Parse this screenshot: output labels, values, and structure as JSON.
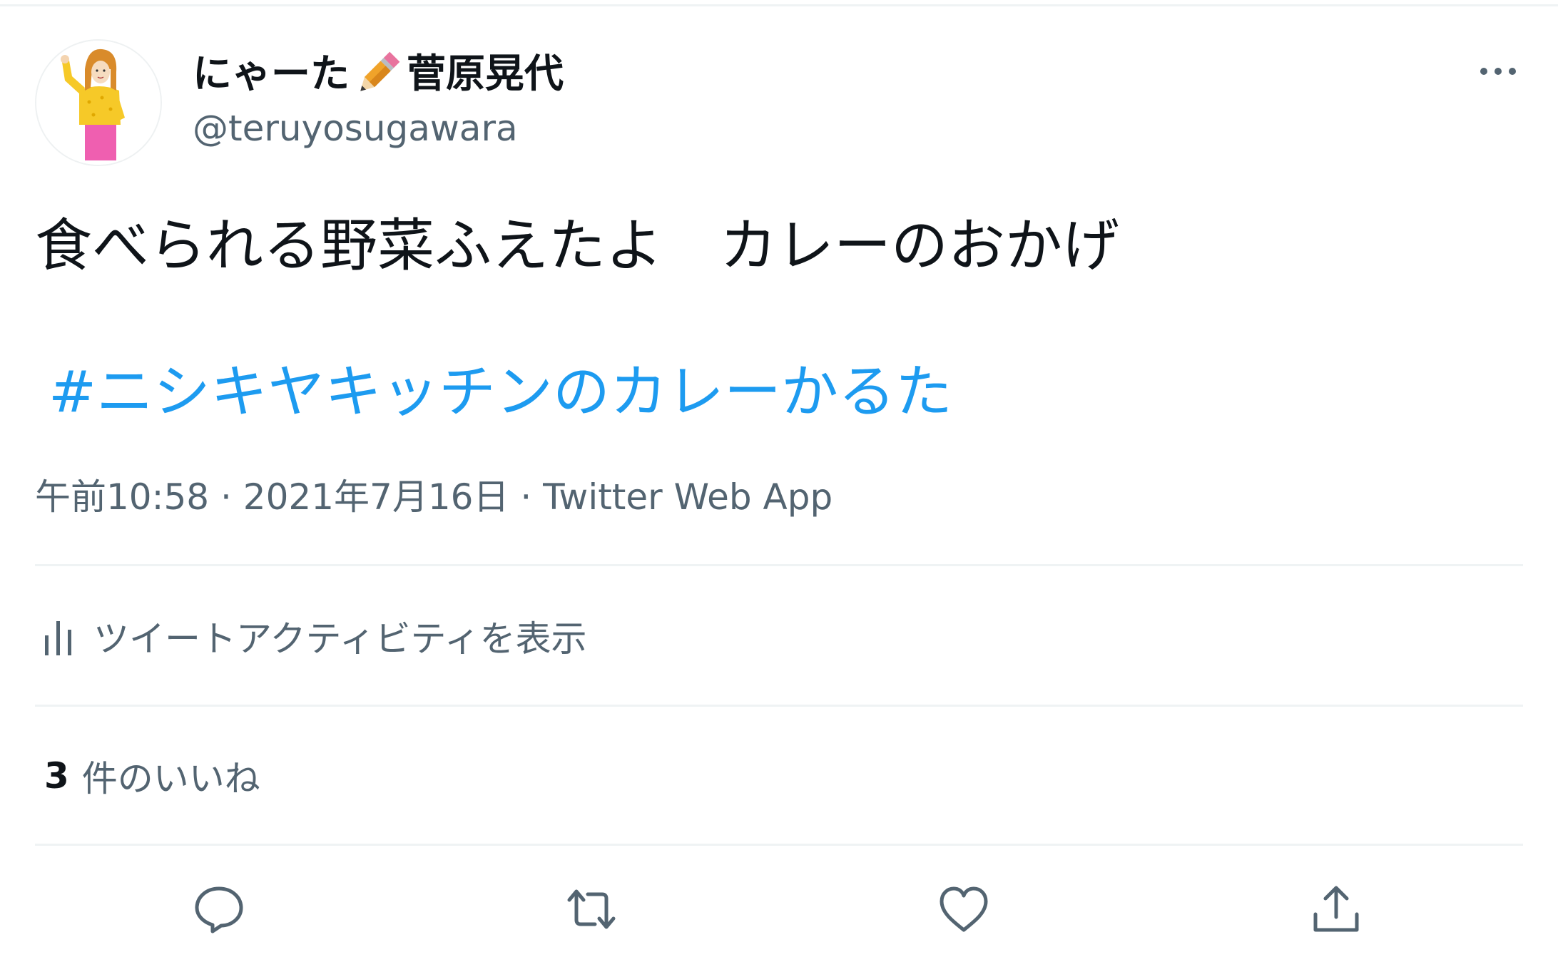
{
  "tweet": {
    "author": {
      "display_name_prefix": "にゃーた",
      "display_name_emoji": "pencil-icon",
      "display_name_suffix": "菅原晃代",
      "handle": "@teruyosugawara",
      "avatar": "avatar-illustration"
    },
    "more_icon": "more-horizontal-icon",
    "text": "食べられる野菜ふえたよ　カレーのおかげ",
    "hashtag": "#ニシキヤキッチンのカレーかるた",
    "meta": {
      "time": "午前10:58",
      "separator": " · ",
      "date": "2021年7月16日",
      "source": "Twitter Web App"
    },
    "activity_label": "ツイートアクティビティを表示",
    "likes": {
      "count": "3",
      "label": "件のいいね"
    },
    "actions": [
      {
        "name": "reply",
        "icon": "reply-icon"
      },
      {
        "name": "retweet",
        "icon": "retweet-icon"
      },
      {
        "name": "like",
        "icon": "heart-icon"
      },
      {
        "name": "share",
        "icon": "share-icon"
      }
    ]
  },
  "colors": {
    "text_primary": "#0f1419",
    "text_secondary": "#536471",
    "link": "#1d9bf0",
    "divider": "#eff3f4",
    "icon": "#536471"
  }
}
